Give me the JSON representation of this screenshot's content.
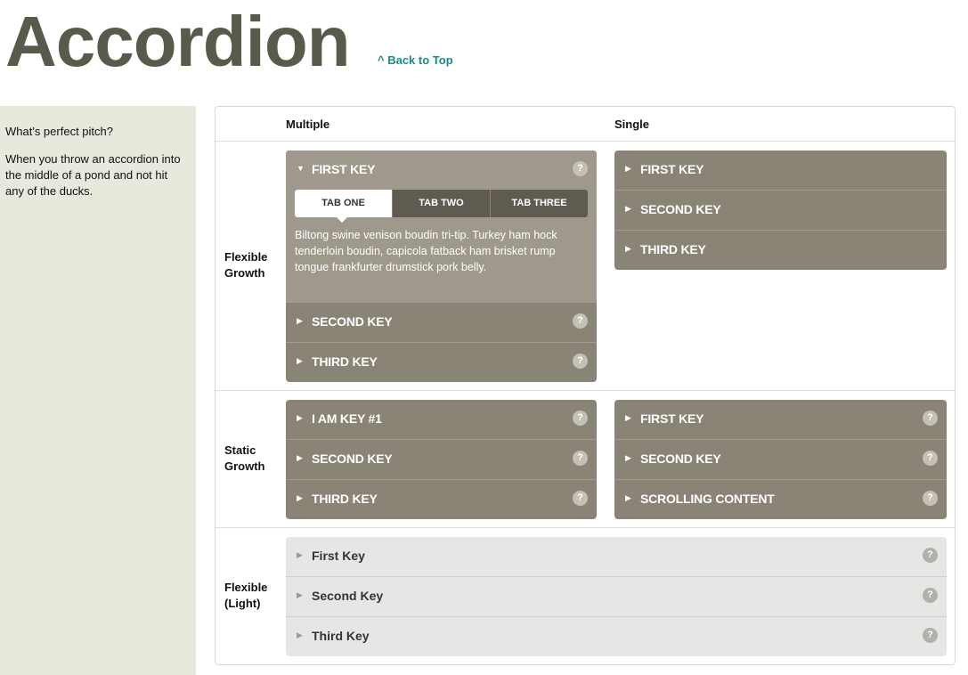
{
  "page": {
    "title": "Accordion",
    "back_to_top": "^ Back to Top"
  },
  "sidebar": {
    "question": "What's perfect pitch?",
    "answer": "When you throw an accordion into the middle of a pond and not hit any of the ducks."
  },
  "columns": {
    "multiple": "Multiple",
    "single": "Single"
  },
  "rows": {
    "flexible_growth": "Flexible Growth",
    "static_growth": "Static Growth",
    "flexible_light": "Flexible (Light)"
  },
  "icons": {
    "help": "?",
    "arrow_right": "▶",
    "arrow_down": "▼"
  },
  "flexible_multiple": {
    "items": [
      "FIRST KEY",
      "SECOND KEY",
      "THIRD KEY"
    ],
    "tabs": [
      "TAB ONE",
      "TAB TWO",
      "TAB THREE"
    ],
    "tab_content": "Biltong swine venison boudin tri-tip. Turkey ham hock tenderloin boudin, capicola fatback ham brisket rump tongue frankfurter drumstick pork belly."
  },
  "flexible_single": {
    "items": [
      "FIRST KEY",
      "SECOND KEY",
      "THIRD KEY"
    ]
  },
  "static_multiple": {
    "items": [
      "I AM KEY #1",
      "SECOND KEY",
      "THIRD KEY"
    ]
  },
  "static_single": {
    "items": [
      "FIRST KEY",
      "SECOND KEY",
      "SCROLLING CONTENT"
    ]
  },
  "light": {
    "items": [
      "First Key",
      "Second Key",
      "Third Key"
    ]
  },
  "colors": {
    "title": "#5a5a4c",
    "link": "#1a8a8a",
    "accordion": "#8a8476",
    "accordion_open": "#9e998c",
    "sidebar": "#e8e8dc"
  }
}
